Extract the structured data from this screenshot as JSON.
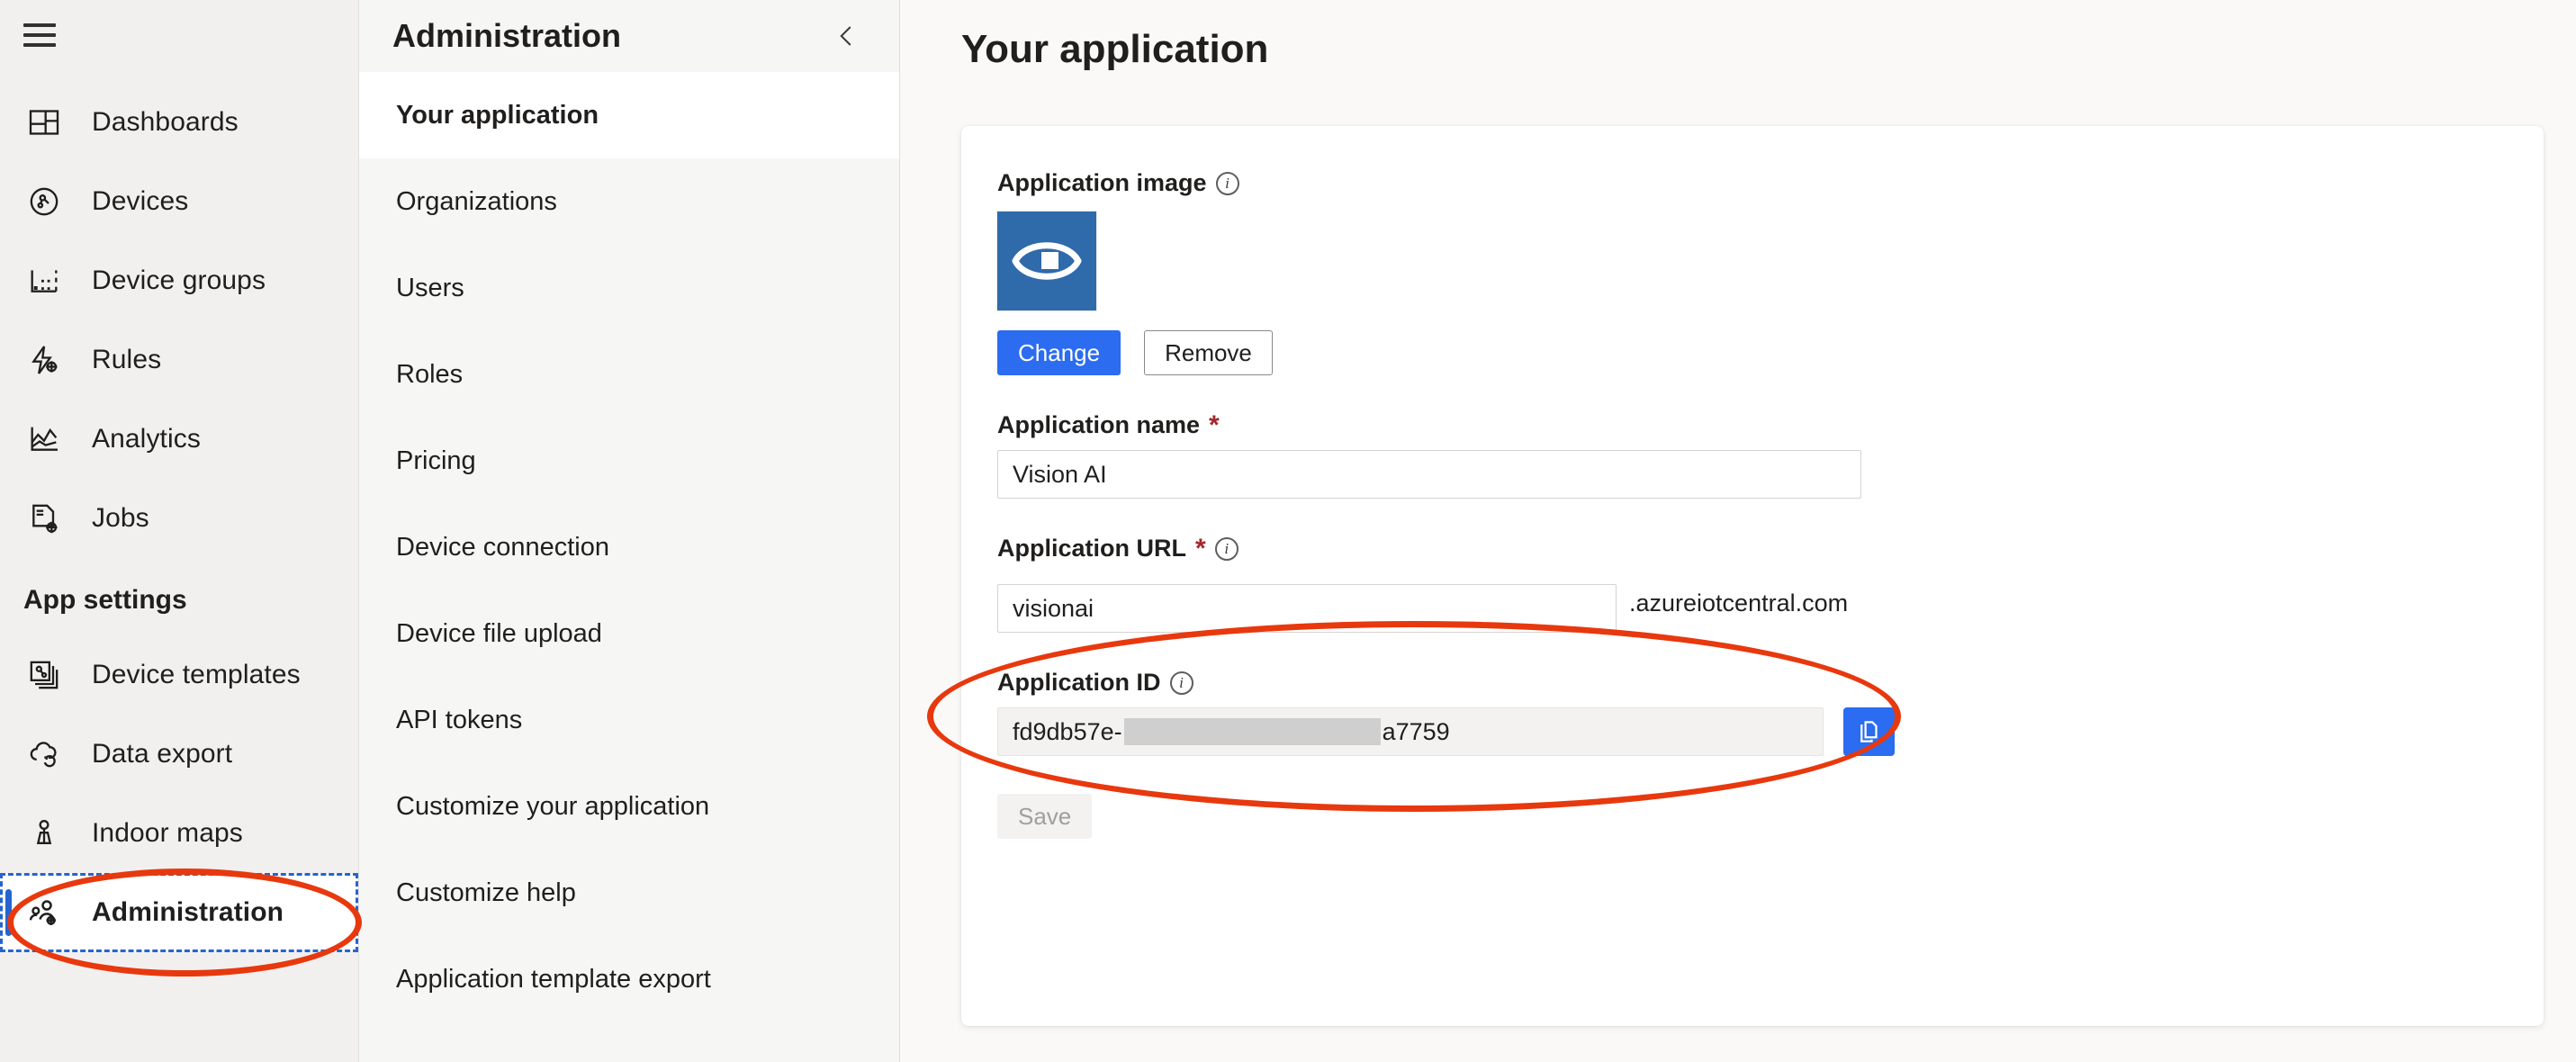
{
  "rail": {
    "menu_toggle": "hamburger-icon",
    "items": [
      {
        "label": "Dashboards",
        "icon": "dashboards-icon"
      },
      {
        "label": "Devices",
        "icon": "devices-icon"
      },
      {
        "label": "Device groups",
        "icon": "device-groups-icon"
      },
      {
        "label": "Rules",
        "icon": "rules-icon"
      },
      {
        "label": "Analytics",
        "icon": "analytics-icon"
      },
      {
        "label": "Jobs",
        "icon": "jobs-icon"
      }
    ],
    "section_title": "App settings",
    "settings_items": [
      {
        "label": "Device templates",
        "icon": "device-templates-icon"
      },
      {
        "label": "Data export",
        "icon": "data-export-icon"
      },
      {
        "label": "Indoor maps",
        "icon": "indoor-maps-icon"
      },
      {
        "label": "Administration",
        "icon": "administration-icon"
      }
    ]
  },
  "subpanel": {
    "title": "Administration",
    "collapse_icon": "chevron-left-icon",
    "items": [
      "Your application",
      "Organizations",
      "Users",
      "Roles",
      "Pricing",
      "Device connection",
      "Device file upload",
      "API tokens",
      "Customize your application",
      "Customize help",
      "Application template export"
    ],
    "active_item": "Your application"
  },
  "main": {
    "page_title": "Your application",
    "app_image": {
      "label": "Application image",
      "info_icon": "info-icon",
      "background_color": "#2f6aab",
      "glyph": "eye-icon",
      "change_label": "Change",
      "remove_label": "Remove"
    },
    "app_name": {
      "label": "Application name",
      "required_marker": "*",
      "value": "Vision AI",
      "placeholder": ""
    },
    "app_url": {
      "label": "Application URL",
      "required_marker": "*",
      "info_icon": "info-icon",
      "value": "visionai",
      "placeholder": "",
      "suffix": ".azureiotcentral.com"
    },
    "app_id": {
      "label": "Application ID",
      "info_icon": "info-icon",
      "value_prefix": "fd9db57e-",
      "value_suffix": "a7759",
      "copy_icon": "copy-icon"
    },
    "save_label": "Save"
  },
  "annotations": {
    "accent_color": "#e8380d",
    "focus_color": "#2564cf",
    "url_highlight": "ellipse around Application URL field",
    "admin_highlight": "ellipse around Administration nav item"
  }
}
